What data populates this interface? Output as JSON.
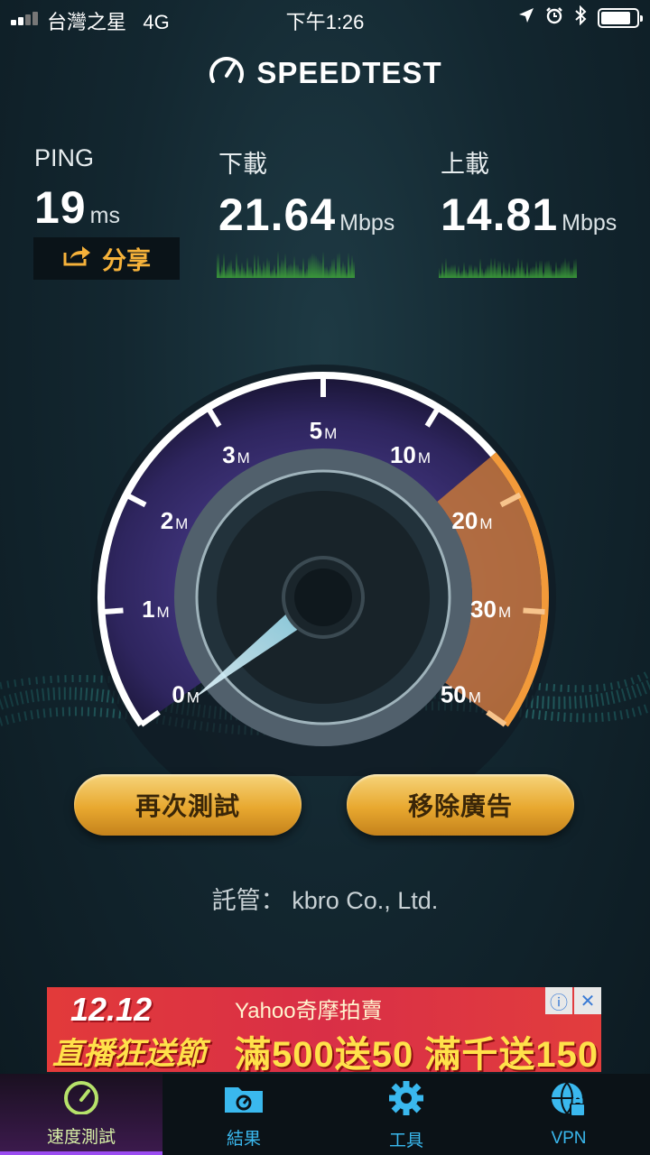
{
  "status_bar": {
    "carrier": "台灣之星",
    "network": "4G",
    "time": "下午1:26",
    "signal_bars": 2,
    "battery_level": 0.85
  },
  "app": {
    "title": "SPEEDTEST"
  },
  "stats": {
    "ping": {
      "label": "PING",
      "value": "19",
      "unit": "ms"
    },
    "download": {
      "label": "下載",
      "value": "21.64",
      "unit": "Mbps"
    },
    "upload": {
      "label": "上載",
      "value": "14.81",
      "unit": "Mbps"
    },
    "share_label": "分享"
  },
  "gauge": {
    "ticks": [
      "0",
      "1",
      "2",
      "3",
      "5",
      "10",
      "20",
      "30",
      "50"
    ],
    "tick_unit": "M",
    "needle_value": "0",
    "colors": {
      "arc": "#ffffff",
      "inner": "#4a3a8c",
      "accent": "#f29a3a"
    }
  },
  "actions": {
    "test_again": "再次測試",
    "remove_ads": "移除廣告"
  },
  "host": {
    "label": "託管：",
    "name": "kbro Co., Ltd."
  },
  "ad": {
    "date": "12.12",
    "brand": "Yahoo奇摩拍賣",
    "tagline": "直播狂送節",
    "promo": "滿500送50 滿千送150",
    "info_icon": "info-icon",
    "close_icon": "close-icon"
  },
  "tabs": [
    {
      "label": "速度測試",
      "icon": "speedometer-icon",
      "active": true
    },
    {
      "label": "結果",
      "icon": "folder-icon",
      "active": false
    },
    {
      "label": "工具",
      "icon": "gear-icon",
      "active": false
    },
    {
      "label": "VPN",
      "icon": "vpn-lock-icon",
      "active": false
    }
  ]
}
